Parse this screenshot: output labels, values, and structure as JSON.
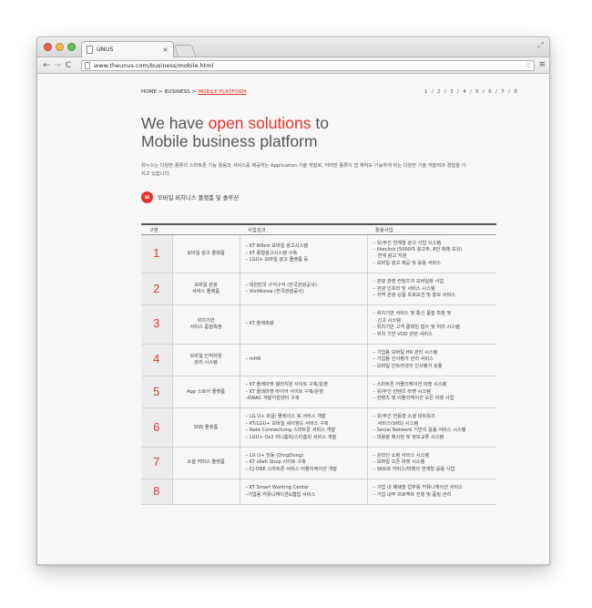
{
  "browser": {
    "tab_title": "UNUS",
    "tab_close": "×",
    "url": "www.theunus.com/business/mobile.html",
    "back": "←",
    "forward": "→",
    "reload": "C",
    "star": "☆",
    "menu": "≡",
    "fullscreen": "⤢"
  },
  "breadcrumb": {
    "prefix": "HOME > BUSINESS > ",
    "current": "MOBILE PLATFORM"
  },
  "pager": "1 / 2 / 3 / 4 / 5 / 6 / 7 / 8",
  "hero": {
    "line1_pre": "We have ",
    "line1_accent": "open solutions",
    "line1_post": " to",
    "line2": "Mobile business platform"
  },
  "intro": "유누스는 다양한 종류의 스마트폰 기능 활용과 서비스를 제공하는 Application 기술 개발로, 어떠한 종류의 앱 제작도 가능하게 하는 다양한 기술 개발력과 경험을 가지고 있습니다.",
  "section": {
    "logo": "u",
    "title": "모바일 비지니스 플랫폼 및 솔루션"
  },
  "table": {
    "headers": [
      "구분",
      "사업성과",
      "활용사업"
    ],
    "rows": [
      {
        "num": "1",
        "name": [
          "모바일 광고 플랫폼"
        ],
        "perf": [
          "– KT Wibro 모바일 광고시스템",
          "– KT 종합광고시스템 구축",
          "– LGU+ 모바일 광고 플랫폼 등"
        ],
        "act": [
          "– 유/무선 연계형 광고 사업 시스템",
          "– likeclick (5000여 광고주, 8만 매체 보유)",
          "   연계 광고 지원",
          "– 모바일 광고 제공 및 응용 서비스"
        ]
      },
      {
        "num": "2",
        "name": [
          "모바일 관광",
          "서비스 플랫폼"
        ],
        "perf": [
          "– 대한민국 구석구석 (한국관광공사)",
          "– VisitKorea (한국관광공사)"
        ],
        "act": [
          "– 관광 관련 컨텐츠의 모바일화 사업",
          "– 관광 인프라 및 서비스 시스템",
          "– 지역 관광 상품 프로모션 및 홍보 서비스"
        ]
      },
      {
        "num": "3",
        "name": [
          "위치기반",
          "서비스 품질측정"
        ],
        "perf": [
          "– KT 올레측량"
        ],
        "act": [
          "– 위치기반 서비스 및 통신 품질 측정 및",
          "   신고 시스템",
          "– 위치기반 고객 클레임 접수 및 처리 시스템",
          "– 위치 기반 VOD 관련 서비스"
        ]
      },
      {
        "num": "4",
        "name": [
          "모바일 인적자원",
          "관리 시스템"
        ],
        "perf": [
          "– mHR"
        ],
        "act": [
          "– 기업용 모바일 HR 관리 시스템",
          "– 기업용 인사평가 관리 서비스",
          "– 모바일 인트라넷의 인사평가 모듈"
        ]
      },
      {
        "num": "5",
        "name": [
          "App 스토어 플랫폼"
        ],
        "perf": [
          "– KT 올레마켓 셀러지원 사이트 구축/운영",
          "– KT 올레마켓 바이어 사이트 구축/운영",
          "–KWAC 개발지원센터 구축"
        ],
        "act": [
          "– 스마트폰 어플리케이션 마켓 시스템",
          "– 유/무선 컨텐츠 마켓 시스템",
          "– 컨텐츠 및 어플리케이션 오픈 마켓 사업"
        ]
      },
      {
        "num": "6",
        "name": [
          "SNS 플랫폼"
        ],
        "perf": [
          "– LG U+ 와글/ 플레이스 북 서비스 개발",
          "– KT/LGU+ 모바일 세이월드 서비스 구축",
          "– Nate Connectiong 스마트폰 서비스 개발",
          "– LGU+ Oz2 미니홈피/스타홈피 서비스 개발"
        ],
        "act": [
          "– 유/무선 연동형 소셜 네트워크",
          "   서비스(SNS) 시스템",
          "– Social Network 기반의 응용 서비스 시스템",
          "– 대용량 메시징 및 정보교류 시스템"
        ]
      },
      {
        "num": "7",
        "name": [
          "소셜 커머스 플랫폼"
        ],
        "perf": [
          "– LG U+ 딩동 (DingDong)",
          "– KT olleh Shop 사이트 구축",
          "– CJ ONE 스마트폰 서비스 어플리케이션 개발"
        ],
        "act": [
          "– 온라인 쇼핑 서비스 시스템",
          "– 모바일 오픈 마켓 시스템",
          "– SNS와 커머스/마켓의 연계형 응용 사업"
        ]
      },
      {
        "num": "8",
        "name": [
          ""
        ],
        "perf": [
          "– KT Smart Working Center",
          "–기업용 커뮤니케이션&협업 서비스"
        ],
        "act": [
          "– 기업 내 폐쇄형 업무용 커뮤니케이션 서비스",
          "– 기업 내부 프로젝트 진행 및 품질 관리"
        ]
      }
    ]
  }
}
